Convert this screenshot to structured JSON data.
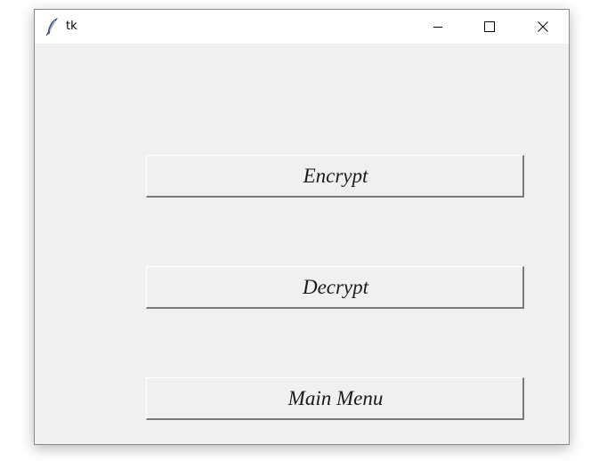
{
  "window": {
    "title": "tk",
    "icon": "feather-icon",
    "controls": {
      "minimize_icon": "minimize-icon",
      "maximize_icon": "maximize-icon",
      "close_icon": "close-icon"
    }
  },
  "buttons": {
    "encrypt_label": "Encrypt",
    "decrypt_label": "Decrypt",
    "main_menu_label": "Main Menu"
  },
  "colors": {
    "background": "#f0f0f0",
    "titlebar": "#ffffff",
    "text": "#1a1a1a"
  }
}
